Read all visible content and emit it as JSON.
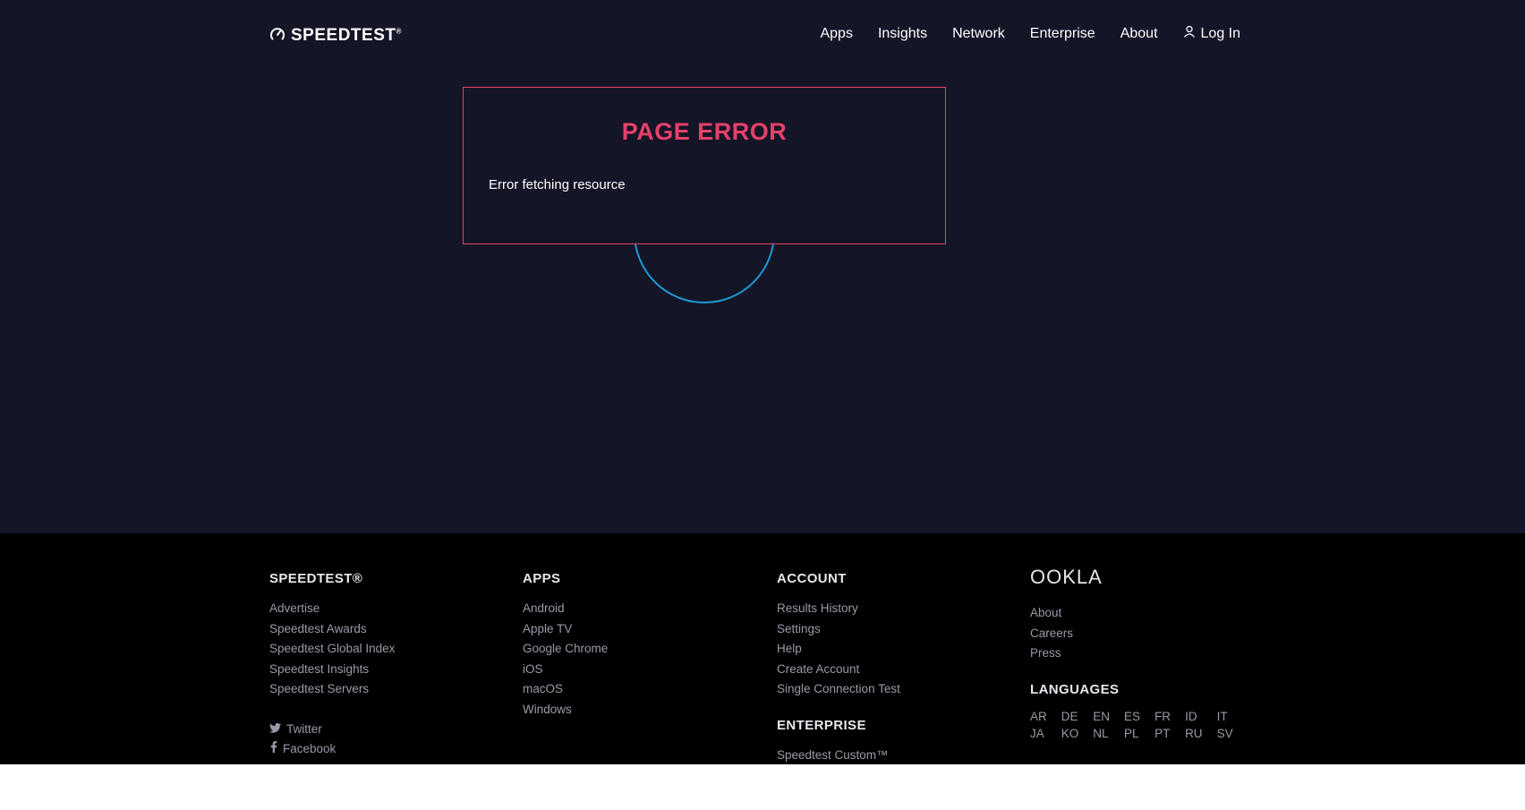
{
  "header": {
    "logo_text": "SPEEDTEST",
    "logo_reg": "®",
    "nav": [
      {
        "label": "Apps"
      },
      {
        "label": "Insights"
      },
      {
        "label": "Network"
      },
      {
        "label": "Enterprise"
      },
      {
        "label": "About"
      }
    ],
    "login_label": "Log In"
  },
  "error": {
    "title": "PAGE ERROR",
    "message": "Error fetching resource"
  },
  "colors": {
    "background": "#141526",
    "footer": "#000000",
    "accent_error": "#e8406b",
    "spinner": "#1c9ad6"
  },
  "footer": {
    "speedtest": {
      "heading": "SPEEDTEST®",
      "links": [
        "Advertise",
        "Speedtest Awards",
        "Speedtest Global Index",
        "Speedtest Insights",
        "Speedtest Servers"
      ],
      "social": [
        {
          "label": "Twitter",
          "icon": "twitter-icon"
        },
        {
          "label": "Facebook",
          "icon": "facebook-icon"
        }
      ]
    },
    "apps": {
      "heading": "APPS",
      "links": [
        "Android",
        "Apple TV",
        "Google Chrome",
        "iOS",
        "macOS",
        "Windows"
      ]
    },
    "account": {
      "heading": "ACCOUNT",
      "links": [
        "Results History",
        "Settings",
        "Help",
        "Create Account",
        "Single Connection Test"
      ]
    },
    "enterprise": {
      "heading": "ENTERPRISE",
      "links": [
        "Speedtest Custom™"
      ]
    },
    "ookla": {
      "logo_text": "OOKLA",
      "links": [
        "About",
        "Careers",
        "Press"
      ]
    },
    "languages": {
      "heading": "LANGUAGES",
      "items": [
        "AR",
        "DE",
        "EN",
        "ES",
        "FR",
        "ID",
        "IT",
        "JA",
        "KO",
        "NL",
        "PL",
        "PT",
        "RU",
        "SV"
      ]
    }
  }
}
